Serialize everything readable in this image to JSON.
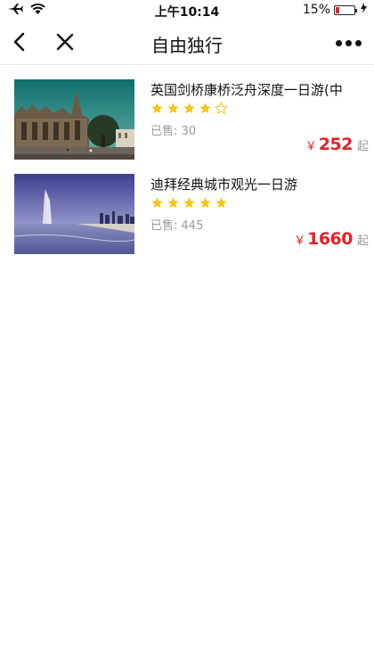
{
  "status": {
    "time": "上午10:14",
    "battery": "15%"
  },
  "nav": {
    "title": "自由独行"
  },
  "icons": {
    "airplane": "airplane-icon",
    "wifi": "wifi-icon",
    "battery": "battery-icon",
    "charging": "charging-icon",
    "back": "chevron-left-icon",
    "close": "close-icon",
    "more": "more-dots-icon",
    "star": "star-icon"
  },
  "colors": {
    "price": "#e5202a",
    "star": "#f5c518"
  },
  "products": [
    {
      "name": "英国剑桥康桥泛舟深度一日游(中",
      "rating": 4,
      "rating_max": 5,
      "sold_label": "已售:",
      "sold_count": "30",
      "currency": "￥",
      "price": "252",
      "price_suffix": "起"
    },
    {
      "name": "迪拜经典城市观光一日游",
      "rating": 5,
      "rating_max": 5,
      "sold_label": "已售:",
      "sold_count": "445",
      "currency": "￥",
      "price": "1660",
      "price_suffix": "起"
    }
  ]
}
